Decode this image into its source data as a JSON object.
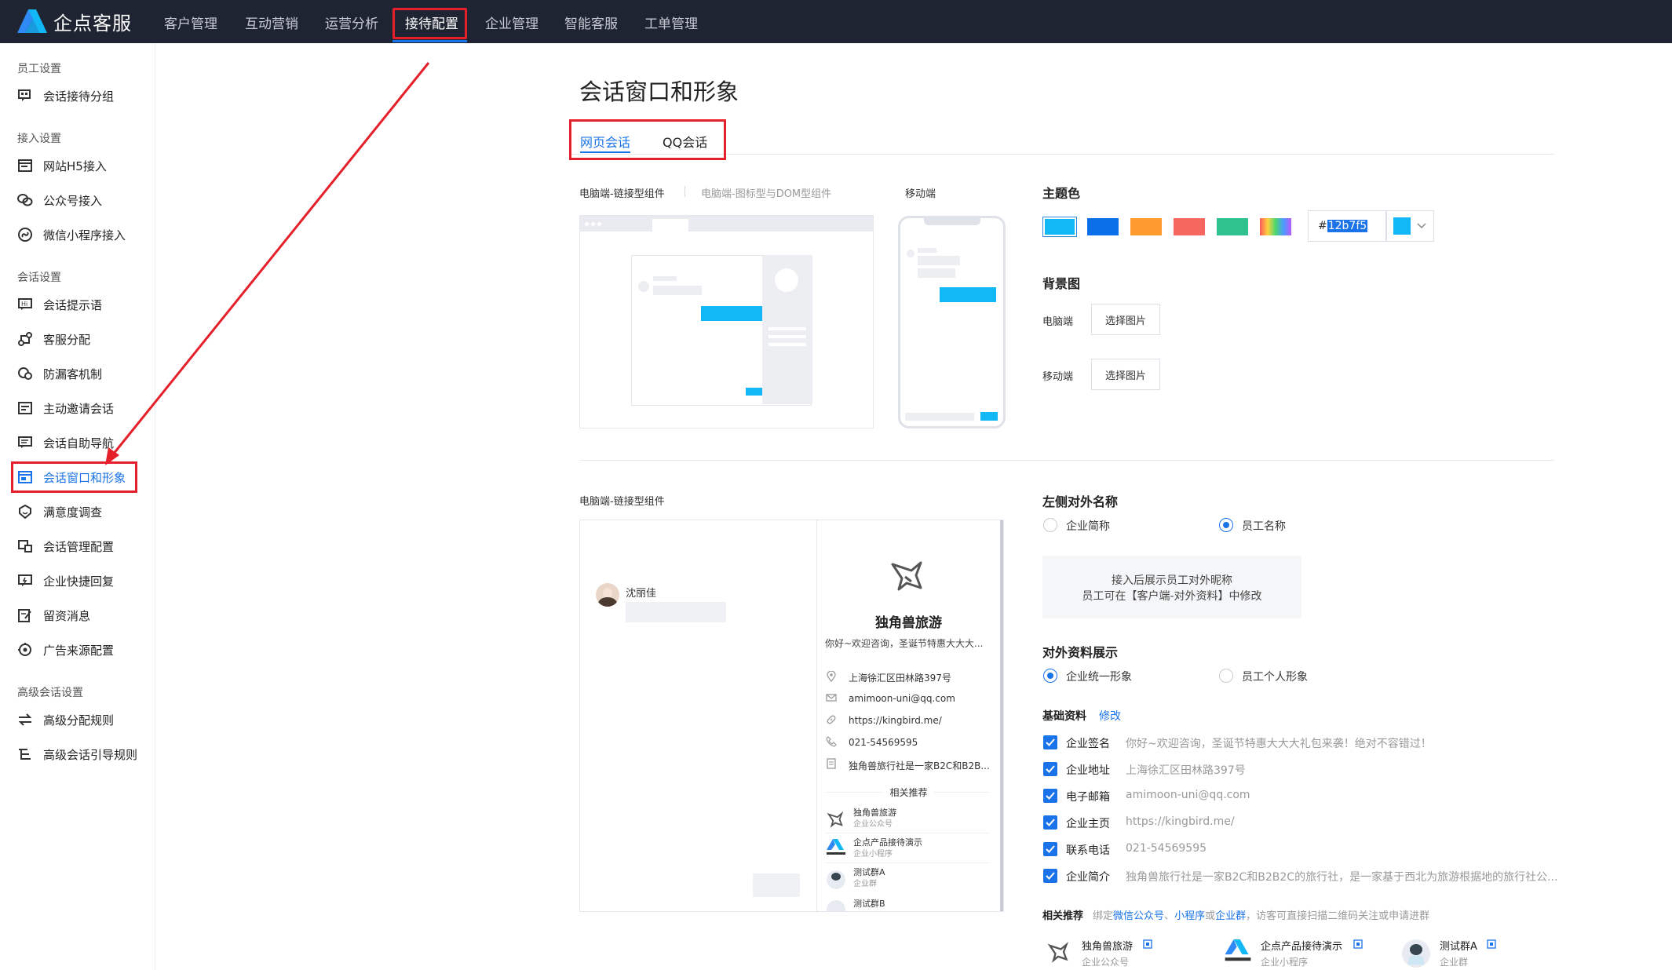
{
  "app": {
    "name": "企点客服"
  },
  "nav": {
    "items": [
      "客户管理",
      "互动营销",
      "运营分析",
      "接待配置",
      "企业管理",
      "智能客服",
      "工单管理"
    ],
    "active_index": 3
  },
  "sidebar": {
    "sections": [
      {
        "title": "员工设置",
        "items": [
          "会话接待分组"
        ]
      },
      {
        "title": "接入设置",
        "items": [
          "网站H5接入",
          "公众号接入",
          "微信小程序接入"
        ]
      },
      {
        "title": "会话设置",
        "items": [
          "会话提示语",
          "客服分配",
          "防漏客机制",
          "主动邀请会话",
          "会话自助导航",
          "会话窗口和形象",
          "满意度调查",
          "会话管理配置",
          "企业快捷回复",
          "留资消息",
          "广告来源配置"
        ]
      },
      {
        "title": "高级会话设置",
        "items": [
          "高级分配规则",
          "高级会话引导规则"
        ]
      }
    ],
    "active_item": "会话窗口和形象"
  },
  "page": {
    "title": "会话窗口和形象",
    "tabs": [
      "网页会话",
      "QQ会话"
    ],
    "active_tab": "网页会话"
  },
  "preview": {
    "pc_link_label": "电脑端-链接型组件",
    "pc_icon_label": "电脑端-图标型与DOM型组件",
    "mobile_label": "移动端",
    "chat_label": "电脑端-链接型组件"
  },
  "theme": {
    "label": "主题色",
    "colors": [
      "#12b7f5",
      "#0a6fe8",
      "#ff9a2e",
      "#f5675f",
      "#2fc28f"
    ],
    "hex_prefix": "#",
    "hex_value": "12b7f5",
    "picker_color": "#12b7f5"
  },
  "background": {
    "label": "背景图",
    "pc_label": "电脑端",
    "mobile_label": "移动端",
    "button_label": "选择图片"
  },
  "external_name": {
    "label": "左侧对外名称",
    "options": [
      "企业简称",
      "员工名称"
    ],
    "selected": "员工名称",
    "hint_line1": "接入后展示员工对外昵称",
    "hint_line2": "员工可在【客户端-对外资料】中修改"
  },
  "profile": {
    "label": "对外资料展示",
    "options": [
      "企业统一形象",
      "员工个人形象"
    ],
    "selected": "企业统一形象",
    "basic_label": "基础资料",
    "edit_link": "修改",
    "fields": [
      {
        "label": "企业签名",
        "value": "你好~欢迎咨询，圣诞节特惠大大大礼包来袭！绝对不容错过！"
      },
      {
        "label": "企业地址",
        "value": "上海徐汇区田林路397号"
      },
      {
        "label": "电子邮箱",
        "value": "amimoon-uni@qq.com"
      },
      {
        "label": "企业主页",
        "value": "https://kingbird.me/"
      },
      {
        "label": "联系电话",
        "value": "021-54569595"
      },
      {
        "label": "企业简介",
        "value": "独角兽旅行社是一家B2C和B2B2C的旅行社，是一家基于西北为旅游根据地的旅行社公..."
      }
    ]
  },
  "recommend": {
    "label": "相关推荐",
    "desc_pre": "绑定",
    "link1": "微信公众号",
    "sep1": "、",
    "link2": "小程序",
    "sep2": "或",
    "link3": "企业群",
    "desc_post": "，访客可直接扫描二维码关注或申请进群",
    "items": [
      {
        "name": "独角兽旅游",
        "type": "企业公众号"
      },
      {
        "name": "企点产品接待演示",
        "type": "企业小程序"
      },
      {
        "name": "测试群A",
        "type": "企业群"
      }
    ]
  },
  "chat_preview": {
    "agent_name": "沈丽佳",
    "company": "独角兽旅游",
    "signature": "你好~欢迎咨询，圣诞节特惠大大大...",
    "address": "上海徐汇区田林路397号",
    "email": "amimoon-uni@qq.com",
    "homepage": "https://kingbird.me/",
    "phone": "021-54569595",
    "intro": "独角兽旅行社是一家B2C和B2B...",
    "related_title": "相关推荐",
    "related": [
      {
        "name": "独角兽旅游",
        "type": "企业公众号"
      },
      {
        "name": "企点产品接待演示",
        "type": "企业小程序"
      },
      {
        "name": "测试群A",
        "type": "企业群"
      },
      {
        "name": "测试群B",
        "type": ""
      }
    ]
  },
  "colors": {
    "accent": "#1a73e8",
    "topbar": "#1e2432",
    "annotation": "#e5202a"
  }
}
